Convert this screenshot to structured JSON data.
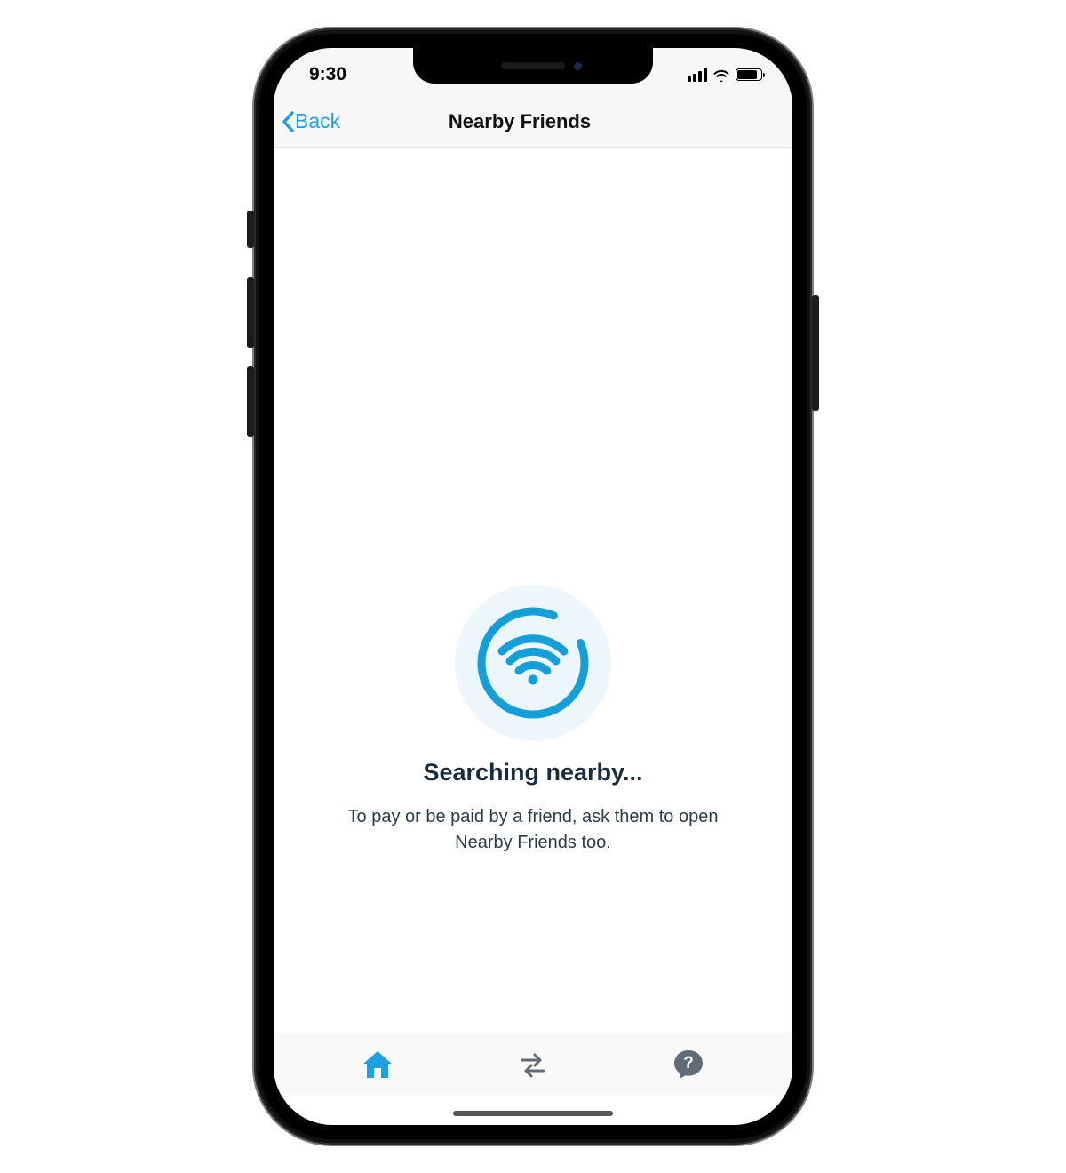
{
  "status_bar": {
    "time": "9:30"
  },
  "nav": {
    "back_label": "Back",
    "title": "Nearby Friends"
  },
  "main": {
    "heading": "Searching nearby...",
    "description": "To pay or be paid by a friend, ask them to open Nearby Friends too."
  },
  "colors": {
    "accent": "#1FA0E3",
    "text_dark": "#1a2b3c",
    "text_body": "#2a3b4c",
    "tab_inactive": "#5f6b77"
  },
  "tabs": {
    "home": {
      "name": "home-icon",
      "active": true
    },
    "transfer": {
      "name": "transfer-icon",
      "active": false
    },
    "help": {
      "name": "help-icon",
      "active": false
    }
  }
}
